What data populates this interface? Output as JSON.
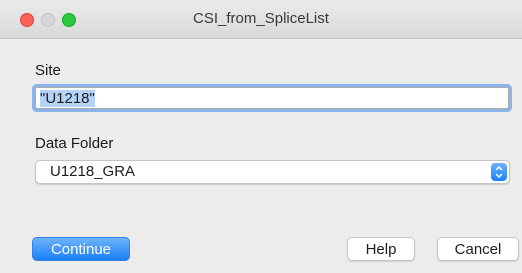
{
  "window": {
    "title": "CSI_from_SpliceList"
  },
  "site": {
    "label": "Site",
    "value": "\"U1218\""
  },
  "data_folder": {
    "label": "Data Folder",
    "selected": "U1218_GRA"
  },
  "buttons": {
    "continue": "Continue",
    "help": "Help",
    "cancel": "Cancel"
  },
  "colors": {
    "accent": "#1a82fb",
    "focus_ring": "#8ab4ea",
    "close": "#fe5f57",
    "zoom": "#28c941"
  }
}
